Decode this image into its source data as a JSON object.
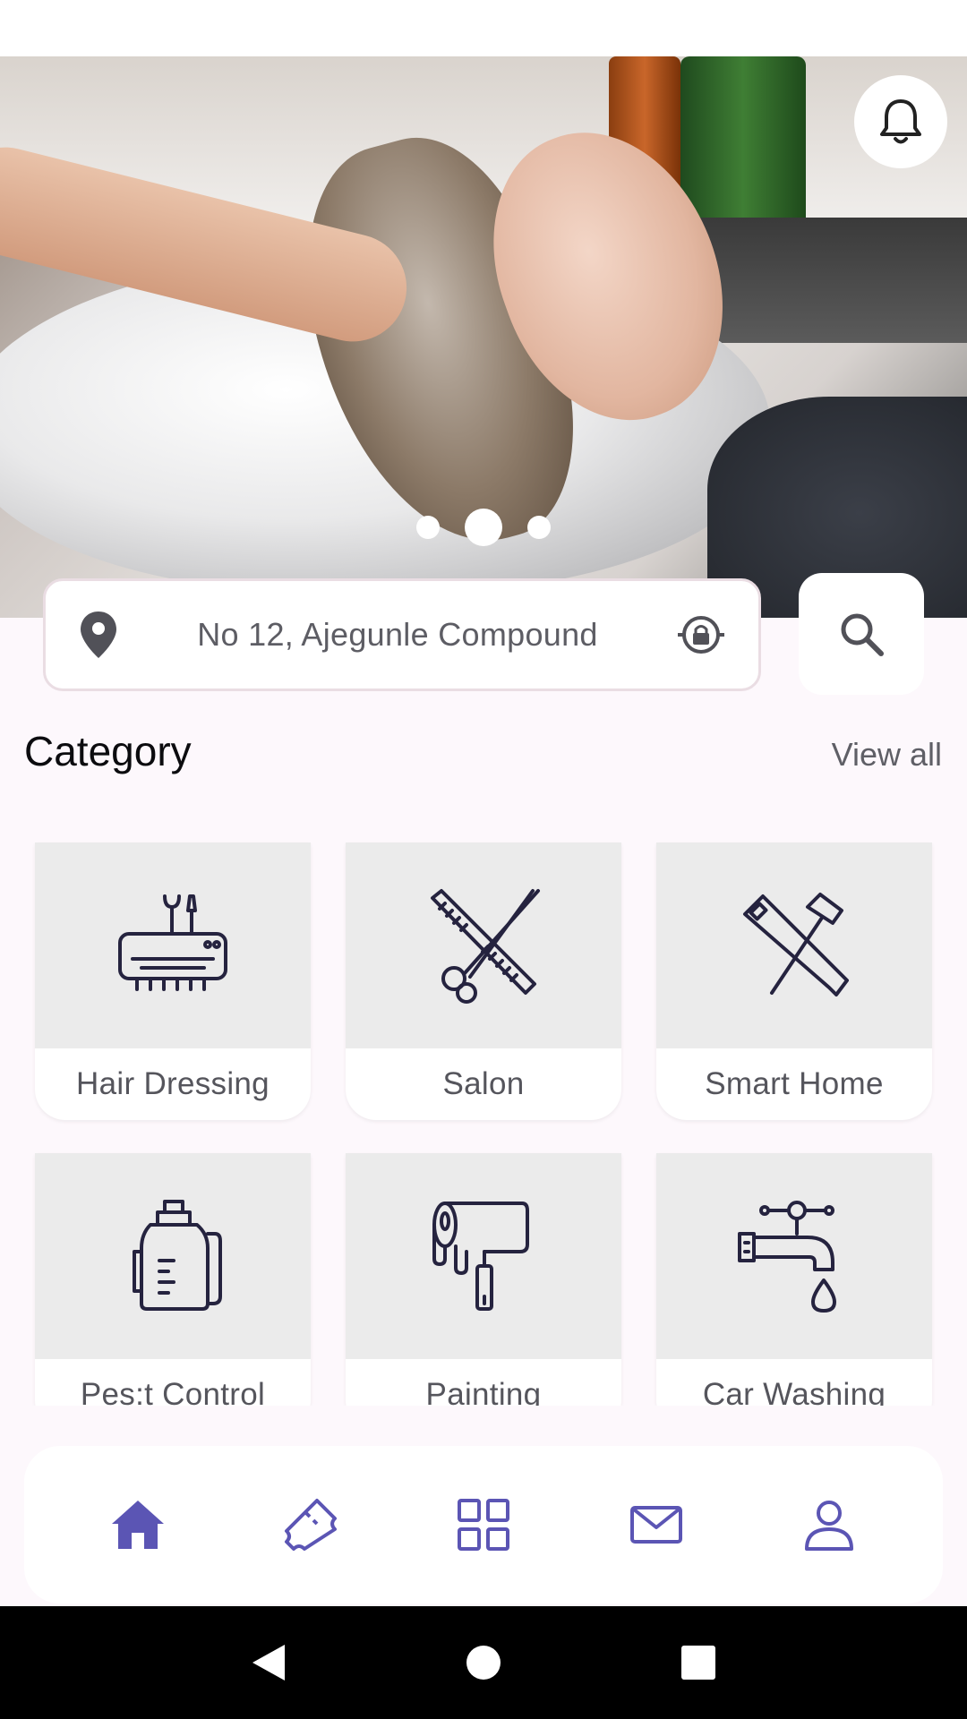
{
  "banner": {
    "carousel_dots": 3,
    "active_dot": 1
  },
  "location": {
    "address": "No 12, Ajegunle Compound"
  },
  "category": {
    "title": "Category",
    "view_all": "View all",
    "items": [
      {
        "label": "Hair Dressing",
        "icon": "air-conditioner-tools-icon"
      },
      {
        "label": "Salon",
        "icon": "scissors-comb-icon"
      },
      {
        "label": "Smart Home",
        "icon": "saw-hammer-icon"
      },
      {
        "label": "Pes:t Control",
        "icon": "sprayer-tank-icon"
      },
      {
        "label": "Painting",
        "icon": "paint-roller-icon"
      },
      {
        "label": "Car Washing",
        "icon": "water-tap-icon"
      }
    ]
  },
  "bottom_nav": {
    "items": [
      "home-icon",
      "ticket-icon",
      "grid-icon",
      "mail-icon",
      "profile-icon"
    ],
    "active": "home-icon"
  },
  "colors": {
    "accent": "#5b55b4",
    "icon_dark": "#25233f",
    "card_image_bg": "#ebebeb",
    "page_bg": "#fdf8fc"
  }
}
